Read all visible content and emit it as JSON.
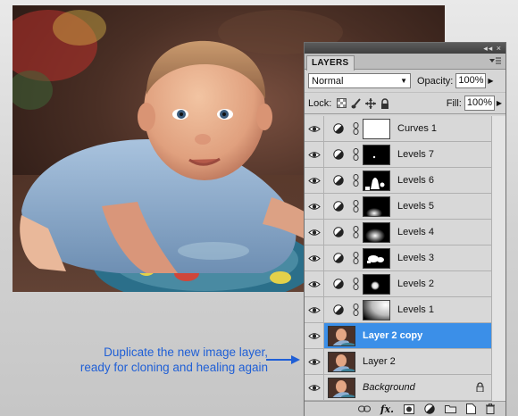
{
  "annotation": {
    "line1": "Duplicate the new image layer,",
    "line2": "ready for cloning and healing again",
    "color": "#1f5fd6"
  },
  "panel": {
    "tab_label": "LAYERS",
    "topbar_controls": "◂◂ ×",
    "menu_icon": "menu-icon",
    "blend_mode": "Normal",
    "opacity_label": "Opacity:",
    "opacity_value": "100%",
    "lock_label": "Lock:",
    "fill_label": "Fill:",
    "fill_value": "100%",
    "selection_color": "#3b8fe8",
    "layers": [
      {
        "name": "Curves 1",
        "kind": "adjustment",
        "mask": "white"
      },
      {
        "name": "Levels 7",
        "kind": "adjustment",
        "mask": "black-dot"
      },
      {
        "name": "Levels 6",
        "kind": "adjustment",
        "mask": "shapes"
      },
      {
        "name": "Levels 5",
        "kind": "adjustment",
        "mask": "soft-blob"
      },
      {
        "name": "Levels 4",
        "kind": "adjustment",
        "mask": "soft-blob-low"
      },
      {
        "name": "Levels 3",
        "kind": "adjustment",
        "mask": "shapes-2"
      },
      {
        "name": "Levels 2",
        "kind": "adjustment",
        "mask": "white-dot"
      },
      {
        "name": "Levels 1",
        "kind": "adjustment",
        "mask": "gradient"
      },
      {
        "name": "Layer 2 copy",
        "kind": "image",
        "selected": true
      },
      {
        "name": "Layer 2",
        "kind": "image"
      },
      {
        "name": "Background",
        "kind": "image",
        "locked": true
      }
    ],
    "footer_icons": [
      "link-layers-icon",
      "fx-icon",
      "add-mask-icon",
      "adjustment-layer-icon",
      "group-folder-icon",
      "new-layer-icon",
      "trash-icon"
    ],
    "footer_fx": "fx."
  }
}
